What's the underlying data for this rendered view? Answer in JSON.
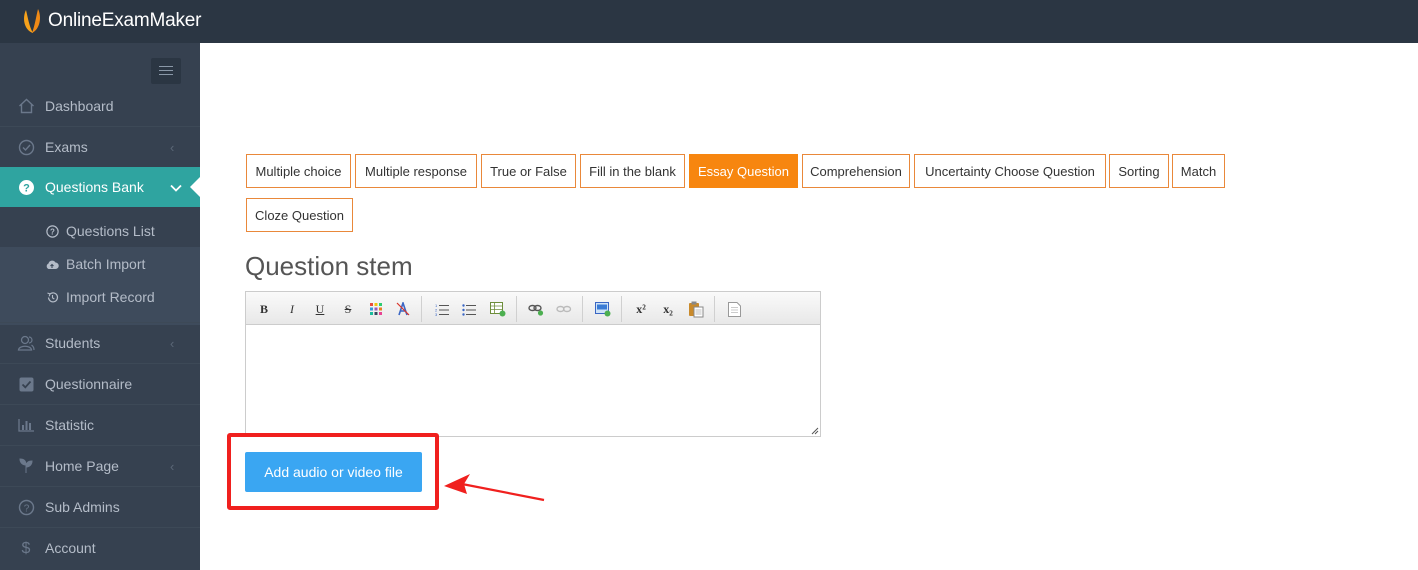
{
  "app": {
    "brand": "OnlineExamMaker"
  },
  "sidebar": {
    "items": [
      {
        "label": "Dashboard",
        "icon": "home-icon"
      },
      {
        "label": "Exams",
        "icon": "check-circle-icon"
      },
      {
        "label": "Questions Bank",
        "icon": "question-circle-icon"
      },
      {
        "label": "Students",
        "icon": "users-icon"
      },
      {
        "label": "Questionnaire",
        "icon": "checkbox-icon"
      },
      {
        "label": "Statistic",
        "icon": "bar-chart-icon"
      },
      {
        "label": "Home Page",
        "icon": "leaf-icon"
      },
      {
        "label": "Sub Admins",
        "icon": "question-circle-icon"
      },
      {
        "label": "Account",
        "icon": "dollar-icon"
      }
    ],
    "sub_items": [
      {
        "label": "Questions List",
        "icon": "question-circle-icon"
      },
      {
        "label": "Batch Import",
        "icon": "cloud-upload-icon"
      },
      {
        "label": "Import Record",
        "icon": "history-icon"
      }
    ]
  },
  "question_types": [
    {
      "label": "Multiple choice"
    },
    {
      "label": "Multiple response"
    },
    {
      "label": "True or False"
    },
    {
      "label": "Fill in the blank"
    },
    {
      "label": "Essay Question",
      "active": true
    },
    {
      "label": "Comprehension"
    },
    {
      "label": "Uncertainty Choose Question"
    },
    {
      "label": "Sorting"
    },
    {
      "label": "Match"
    },
    {
      "label": "Cloze Question"
    }
  ],
  "editor": {
    "title": "Question stem",
    "toolbar": {
      "bold": "B",
      "italic": "I",
      "underline": "U",
      "strike": "S",
      "superscript": "x²",
      "subscript": "x₂"
    },
    "content": ""
  },
  "actions": {
    "add_media_label": "Add audio or video file"
  },
  "colors": {
    "topbar": "#2b3643",
    "sidebar": "#364150",
    "active_nav": "#2fa4a0",
    "tab_border": "#e9883a",
    "tab_active": "#f7860f",
    "primary_button": "#3aa6f2",
    "annotation": "#f0201e"
  }
}
